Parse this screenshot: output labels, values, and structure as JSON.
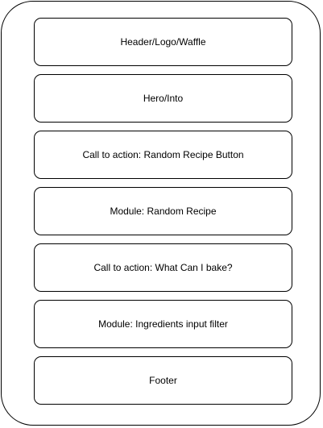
{
  "frame": {
    "border_color": "#000000",
    "background_color": "#ffffff"
  },
  "blocks": [
    {
      "label": "Header/Logo/Waffle"
    },
    {
      "label": "Hero/Into"
    },
    {
      "label": "Call to action: Random Recipe Button"
    },
    {
      "label": "Module: Random Recipe"
    },
    {
      "label": "Call to action: What Can I bake?"
    },
    {
      "label": "Module: Ingredients input filter"
    },
    {
      "label": "Footer"
    }
  ]
}
